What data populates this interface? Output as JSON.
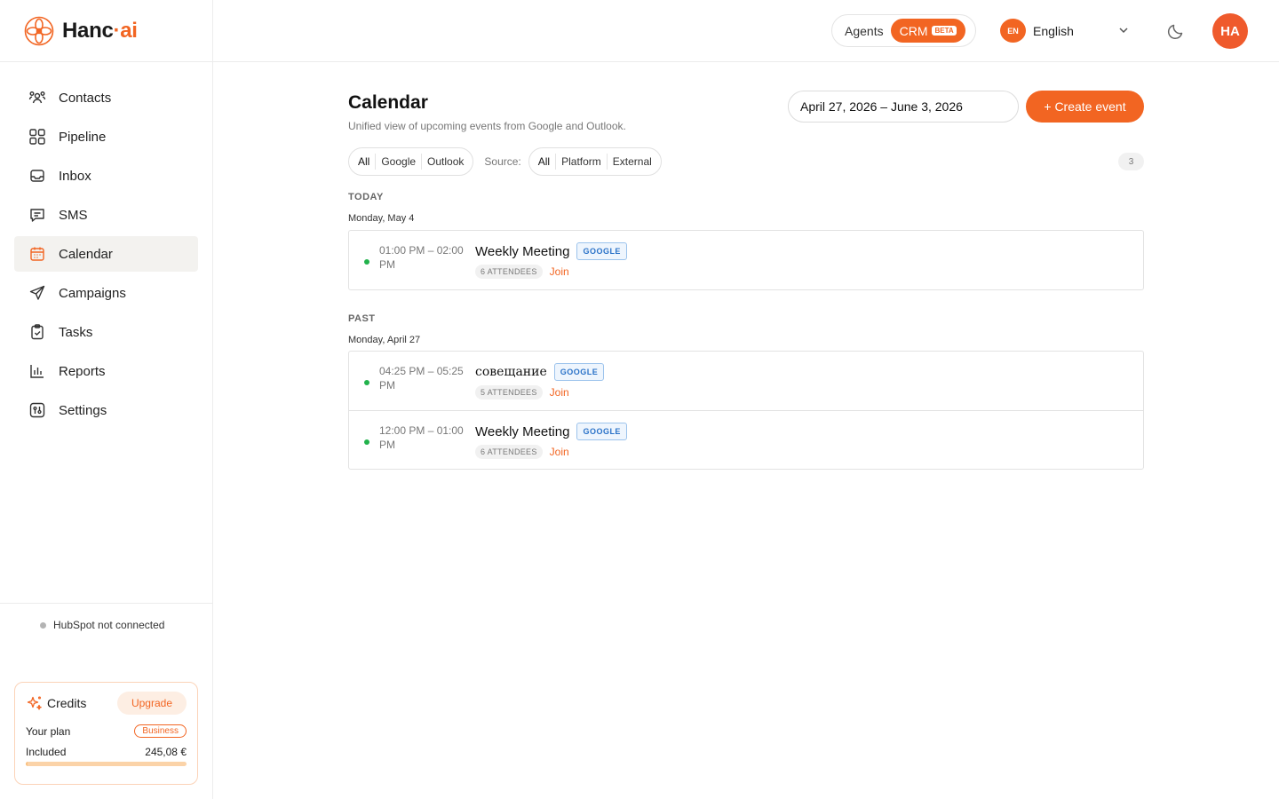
{
  "brand": {
    "name_part1": "Hanc",
    "name_sep": "·",
    "name_part2": "ai",
    "accent": "#f26522"
  },
  "sidebar": {
    "items": [
      {
        "label": "Contacts",
        "icon": "contacts-icon",
        "active": false
      },
      {
        "label": "Pipeline",
        "icon": "pipeline-icon",
        "active": false
      },
      {
        "label": "Inbox",
        "icon": "inbox-icon",
        "active": false
      },
      {
        "label": "SMS",
        "icon": "sms-icon",
        "active": false
      },
      {
        "label": "Calendar",
        "icon": "calendar-icon",
        "active": true
      },
      {
        "label": "Campaigns",
        "icon": "send-icon",
        "active": false
      },
      {
        "label": "Tasks",
        "icon": "clipboard-icon",
        "active": false
      },
      {
        "label": "Reports",
        "icon": "bar-chart-icon",
        "active": false
      },
      {
        "label": "Settings",
        "icon": "settings-icon",
        "active": false
      }
    ],
    "hubspot_status": "HubSpot not connected",
    "credits": {
      "title": "Credits",
      "upgrade_label": "Upgrade",
      "plan_label": "Your plan",
      "plan_value": "Business",
      "included_label": "Included",
      "included_value": "245,08 €",
      "usage_fraction": 0.01
    }
  },
  "topbar": {
    "mode_agents": "Agents",
    "mode_crm": "CRM",
    "beta_badge": "BETA",
    "language_code": "EN",
    "language_name": "English",
    "avatar_initials": "HA"
  },
  "page": {
    "title": "Calendar",
    "subtitle": "Unified view of upcoming events from Google and Outlook.",
    "date_range": "April 27, 2026 – June 3, 2026",
    "create_button": "+ Create event",
    "provider_filter": [
      "All",
      "Google",
      "Outlook"
    ],
    "source_label": "Source:",
    "source_filter": [
      "All",
      "Platform",
      "External"
    ],
    "event_count": "3"
  },
  "sections": [
    {
      "label": "TODAY",
      "day": "Monday, May 4",
      "events": [
        {
          "time": "01:00 PM – 02:00 PM",
          "title": "Weekly Meeting",
          "provider": "GOOGLE",
          "attendees": "6 ATTENDEES",
          "join": "Join"
        }
      ]
    },
    {
      "label": "PAST",
      "day": "Monday, April 27",
      "events": [
        {
          "time": "04:25 PM – 05:25 PM",
          "title": "совещание",
          "provider": "GOOGLE",
          "attendees": "5 ATTENDEES",
          "join": "Join"
        },
        {
          "time": "12:00 PM – 01:00 PM",
          "title": "Weekly Meeting",
          "provider": "GOOGLE",
          "attendees": "6 ATTENDEES",
          "join": "Join"
        }
      ]
    }
  ]
}
